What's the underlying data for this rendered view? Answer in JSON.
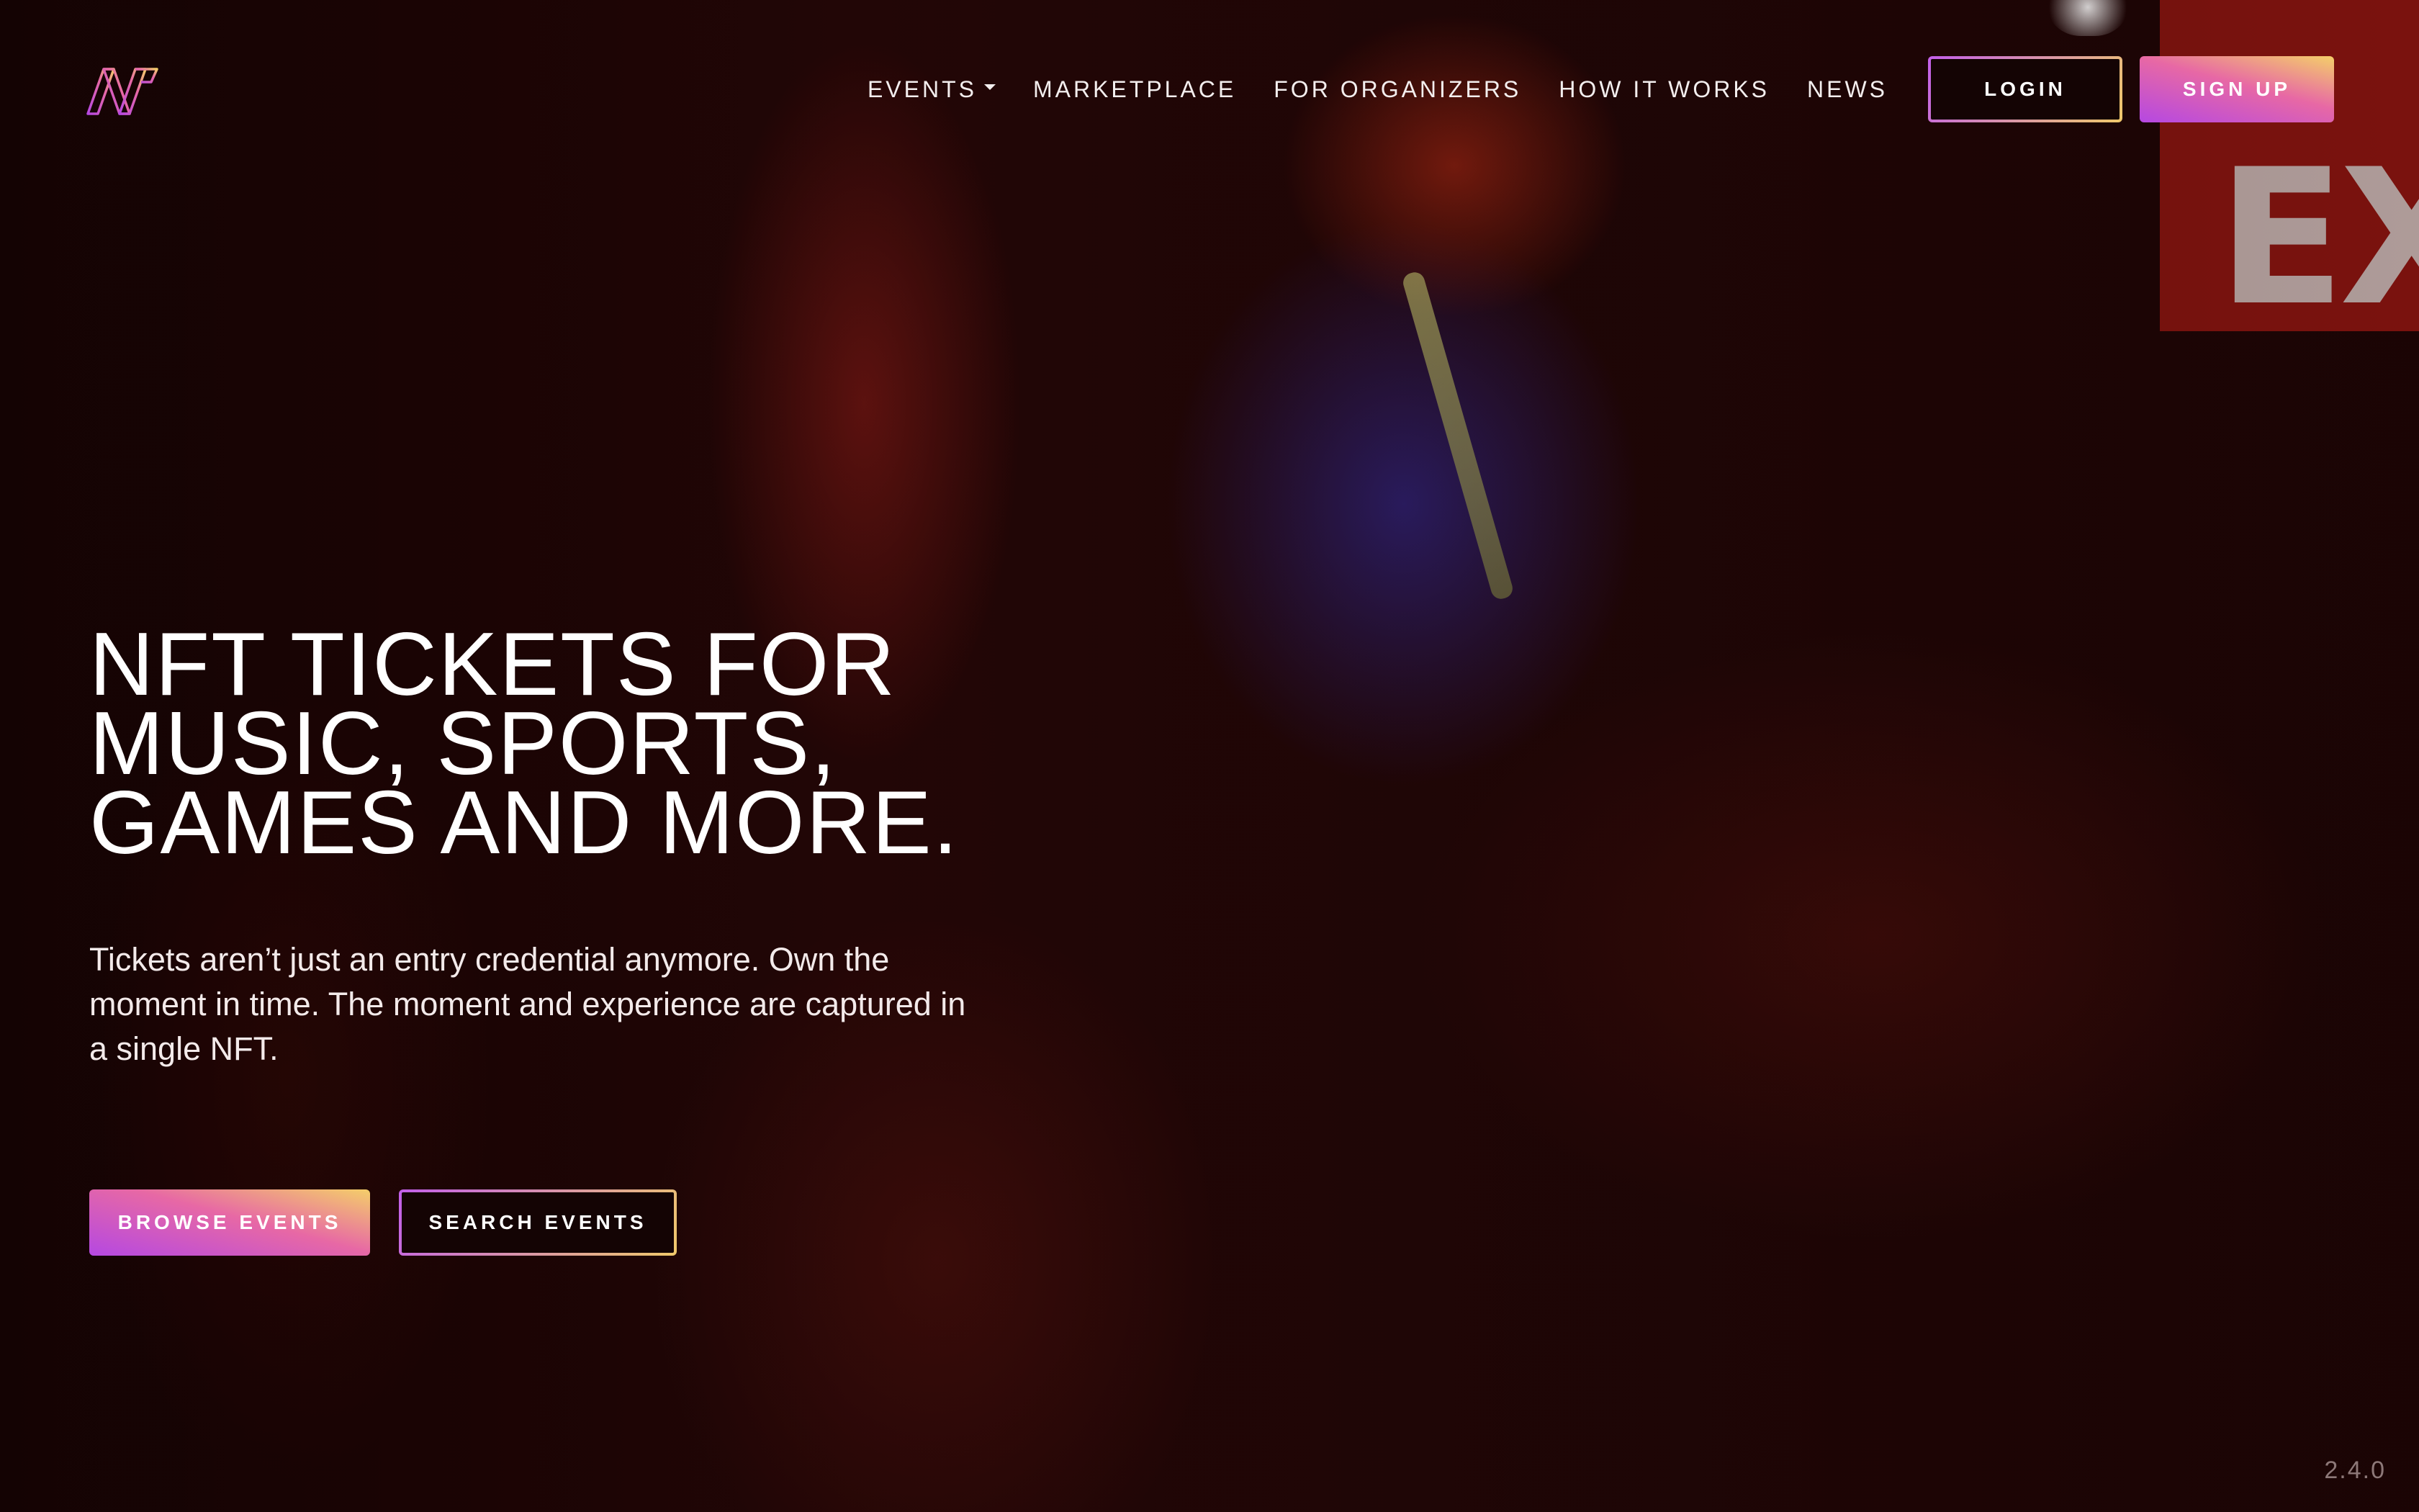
{
  "brand": {
    "logo_icon": "hexagon-n-logo-icon",
    "gradient_start": "#b548e2",
    "gradient_end": "#f4cf69"
  },
  "nav": {
    "items": [
      {
        "label": "EVENTS",
        "has_dropdown": true
      },
      {
        "label": "MARKETPLACE"
      },
      {
        "label": "FOR ORGANIZERS"
      },
      {
        "label": "HOW IT WORKS"
      },
      {
        "label": "NEWS"
      }
    ],
    "login_label": "LOGIN",
    "signup_label": "SIGN UP"
  },
  "hero": {
    "headline_lines": [
      "NFT TICKETS FOR",
      "MUSIC, SPORTS,",
      "GAMES AND MORE."
    ],
    "subtext": "Tickets aren’t just an entry credential anymore. Own the moment in time. The moment and experience are captured in a single NFT.",
    "browse_label": "BROWSE EVENTS",
    "search_label": "SEARCH EVENTS"
  },
  "footer": {
    "version": "2.4.0"
  }
}
